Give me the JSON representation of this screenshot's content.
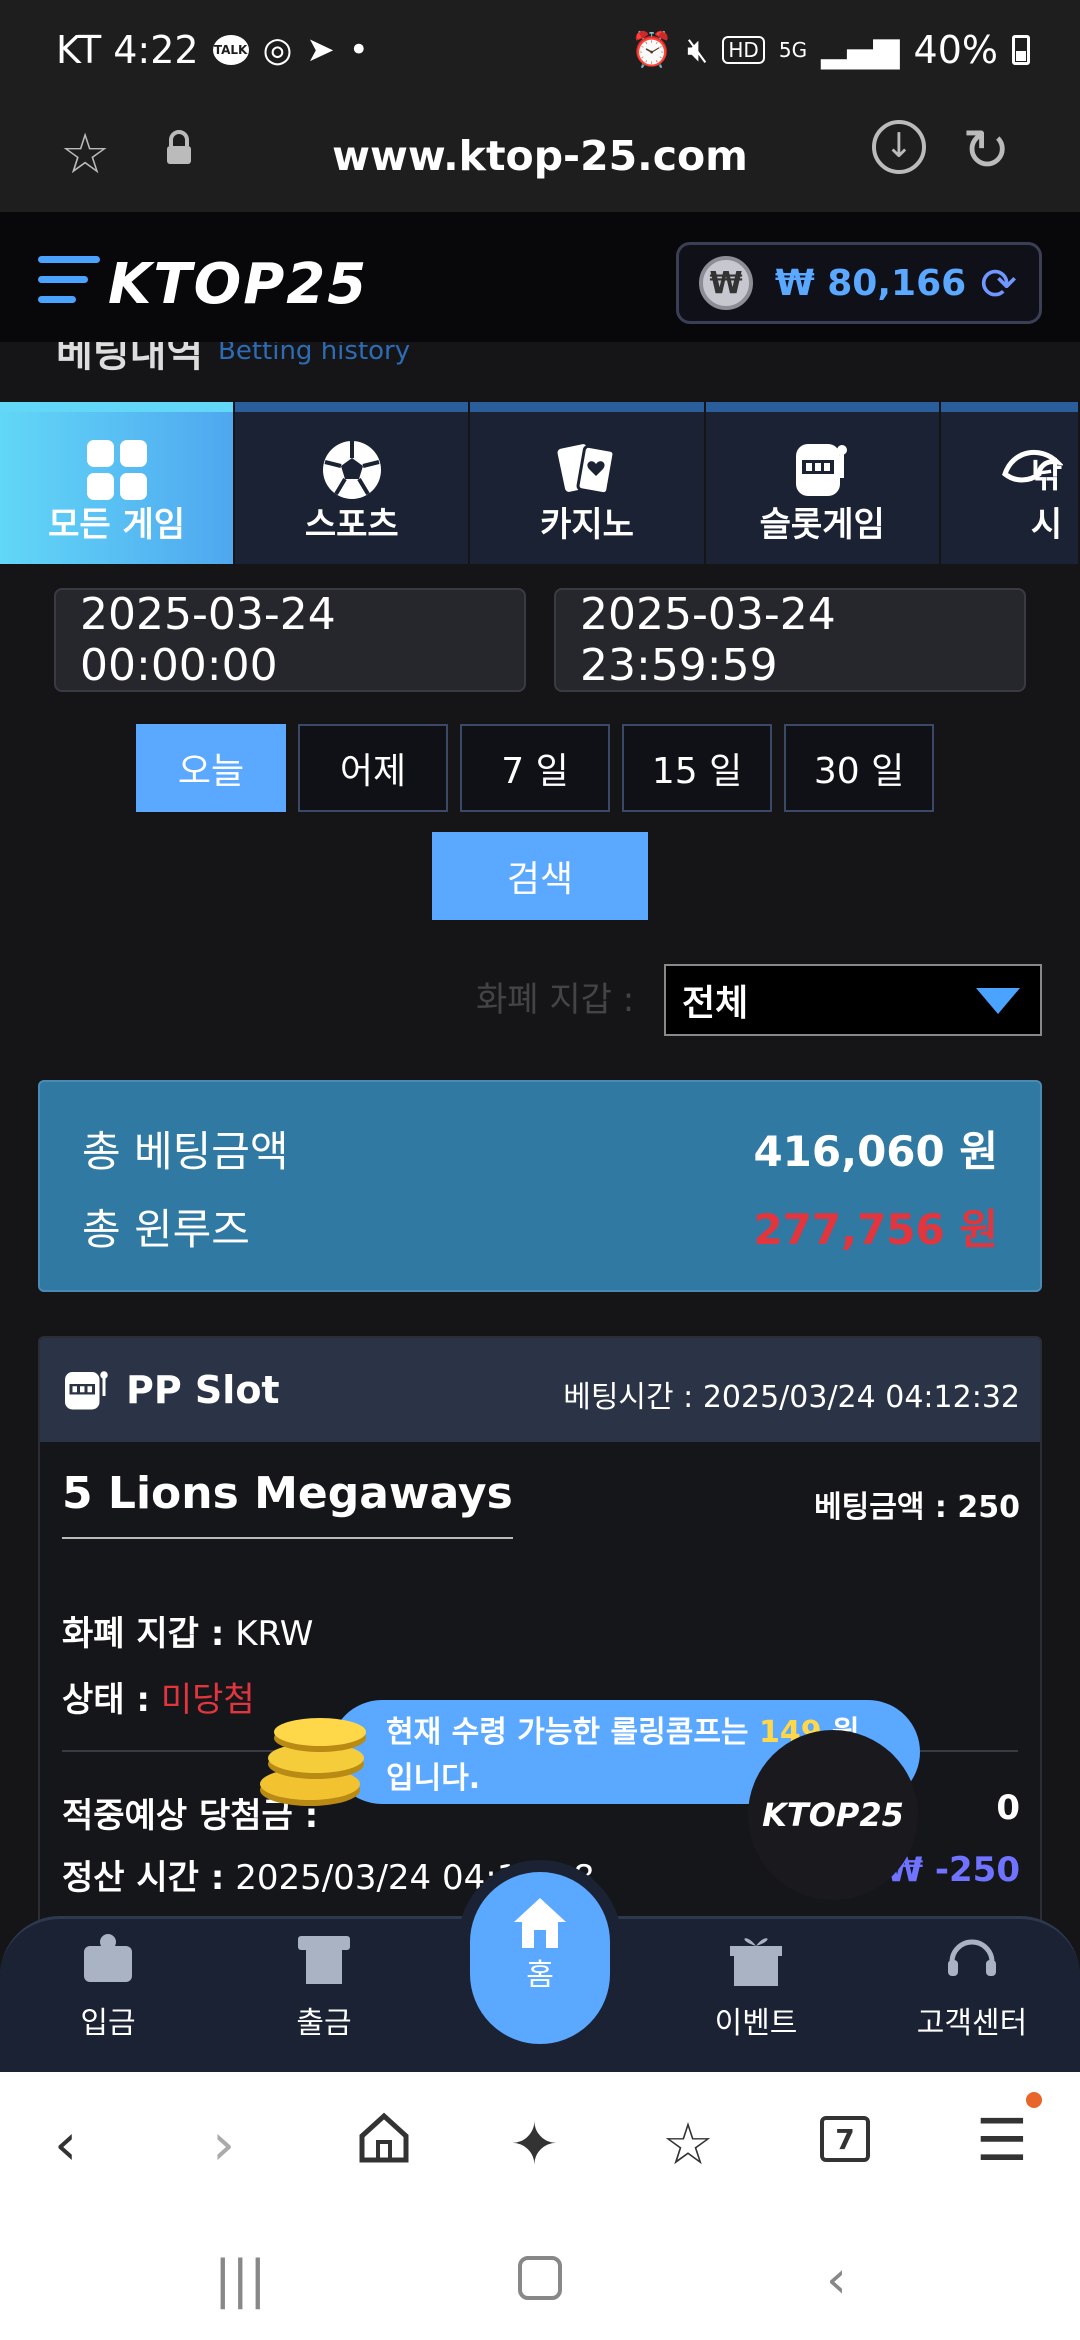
{
  "status": {
    "carrier_time": "KT 4:22",
    "talk_badge": "TALK",
    "battery": "40%",
    "notification_dot": "•",
    "hd_badge": "HD",
    "network_badge": "5G"
  },
  "browser": {
    "url": "www.ktop-25.com",
    "tabs_count": "7"
  },
  "site": {
    "logo": "KTOP25",
    "balance": "₩ 80,166",
    "currency_symbol": "₩",
    "page_title_ko": "베팅내역",
    "page_title_en": "Betting history"
  },
  "categories": [
    {
      "label": "모든 게임",
      "icon": "grid-icon",
      "active": true
    },
    {
      "label": "스포츠",
      "icon": "soccer-ball-icon",
      "active": false
    },
    {
      "label": "카지노",
      "icon": "cards-icon",
      "active": false
    },
    {
      "label": "슬롯게임",
      "icon": "slot-machine-icon",
      "active": false
    },
    {
      "label": "낚시",
      "icon": "fish-icon",
      "active": false
    }
  ],
  "filter": {
    "start_date": "2025-03-24 00:00:00",
    "end_date": "2025-03-24 23:59:59",
    "periods": [
      "오늘",
      "어제",
      "7 일",
      "15 일",
      "30 일"
    ],
    "search_label": "검색",
    "wallet_label": "화폐 지갑 :",
    "wallet_value": "전체"
  },
  "summary": {
    "total_bet_label": "총 베팅금액",
    "total_bet_value": "416,060 원",
    "total_winloss_label": "총 윈루즈",
    "total_winloss_value": "277,756 원"
  },
  "bet": {
    "provider": "PP Slot",
    "bet_time_label": "베팅시간 :",
    "bet_time": "2025/03/24 04:12:32",
    "game_name": "5 Lions Megaways",
    "bet_amount_label": "베팅금액 :",
    "bet_amount": "250",
    "wallet_label": "화폐 지갑 :",
    "wallet": "KRW",
    "status_label": "상태 :",
    "status": "미당첨",
    "expected_label": "적중예상 당첨금 :",
    "expected": "0",
    "settle_label": "정산 시간 :",
    "settle_time": "2025/03/24 04:14:08",
    "result": "₩ -250"
  },
  "popup": {
    "text_before": "현재 수령 가능한 롤링콤프는 ",
    "amount": "149",
    "text_after": " 원",
    "line2": "입니다."
  },
  "bottom_nav": [
    {
      "label": "입금",
      "icon": "deposit-icon"
    },
    {
      "label": "출금",
      "icon": "withdraw-icon"
    },
    {
      "label": "홈",
      "icon": "home-icon"
    },
    {
      "label": "이벤트",
      "icon": "gift-icon"
    },
    {
      "label": "고객센터",
      "icon": "headset-icon"
    }
  ],
  "colors": {
    "accent": "#5aa8ff",
    "summary_bg": "#2f79a2",
    "loss_red": "#e2353d",
    "status_red": "#e2353d",
    "result_blue": "#6f73ff",
    "highlight_yellow": "#ffd84a"
  }
}
